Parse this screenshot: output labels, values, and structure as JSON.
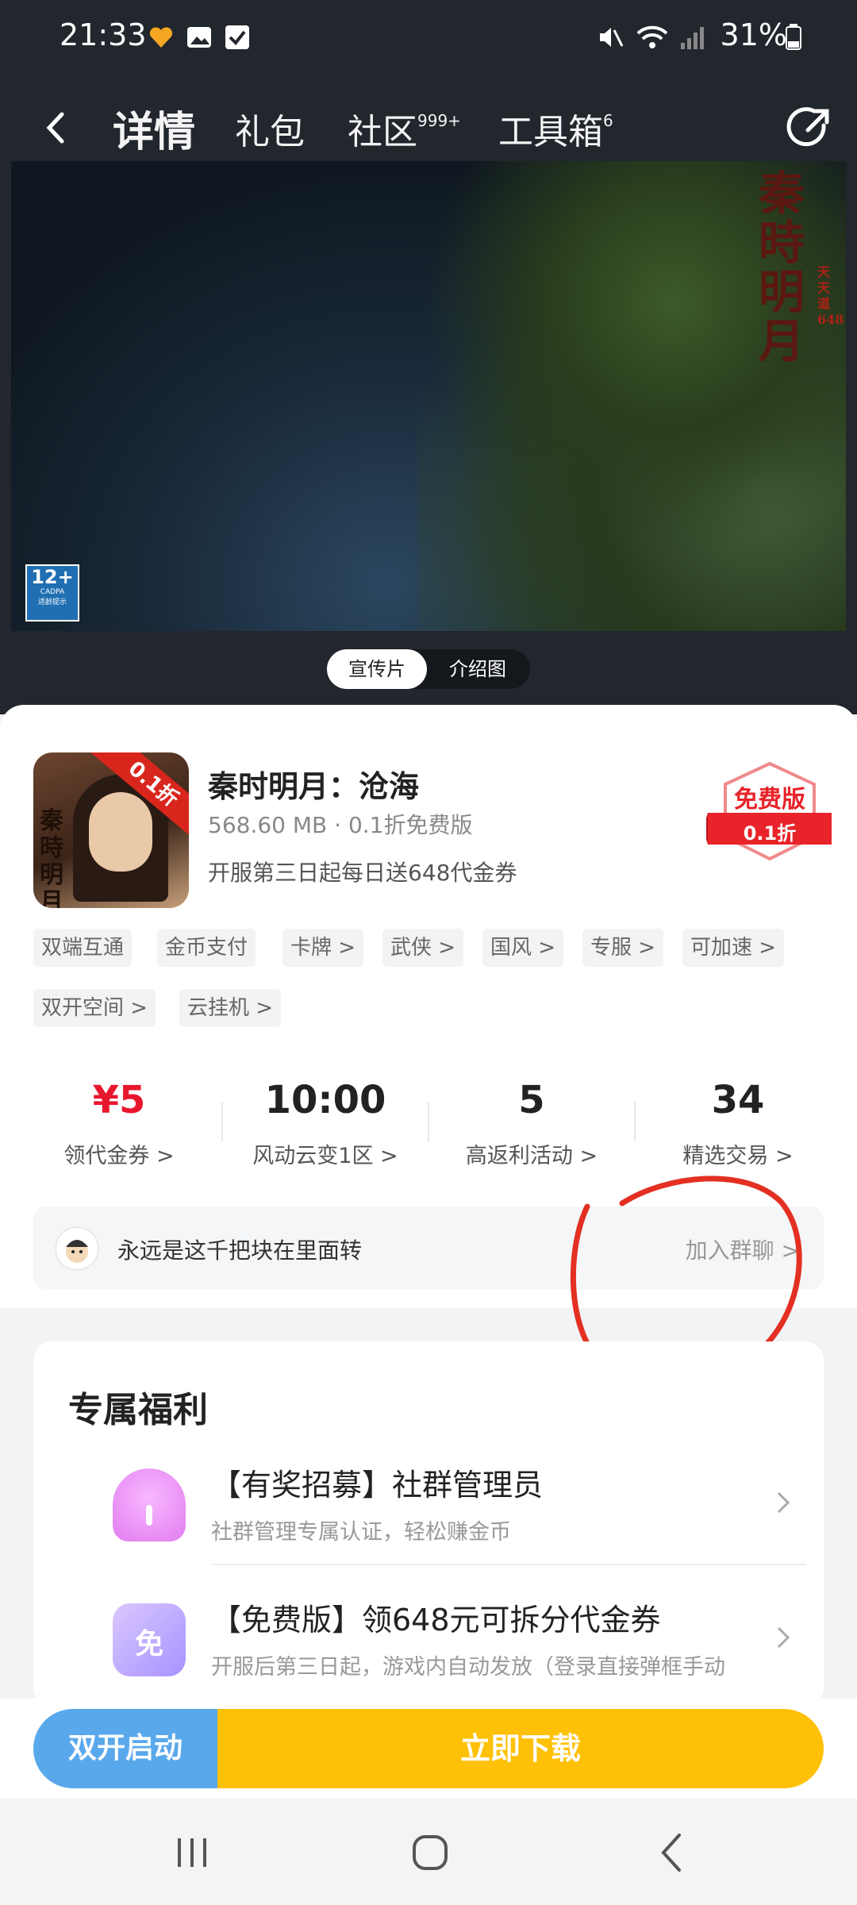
{
  "status_bar": {
    "time": "21:33",
    "battery": "31%"
  },
  "nav": {
    "tabs": [
      {
        "label": "详情",
        "badge": ""
      },
      {
        "label": "礼包",
        "badge": ""
      },
      {
        "label": "社区",
        "badge": "999+"
      },
      {
        "label": "工具箱",
        "badge": "6"
      }
    ]
  },
  "media": {
    "age_rating": "12+",
    "age_sub": "CADPA",
    "age_note": "适龄提示",
    "watermark": "秦時明月",
    "watermark_small": "天天道 648",
    "switch": [
      "宣传片",
      "介绍图"
    ]
  },
  "app": {
    "icon_ribbon": "0.1折",
    "icon_calli": "秦時明月",
    "title": "秦时明月：沧海",
    "meta": "568.60 MB · 0.1折免费版",
    "promo": "开服第三日起每日送648代金券",
    "badge_main": "免费版",
    "badge_sub": "0.1折"
  },
  "tags": [
    "双端互通",
    "金币支付",
    "卡牌 >",
    "武侠 >",
    "国风 >",
    "专服 >",
    "可加速 >",
    "双开空间 >",
    "云挂机 >"
  ],
  "stats": [
    {
      "value": "¥5",
      "label": "领代金券 >"
    },
    {
      "value": "10:00",
      "label": "风动云变1区 >"
    },
    {
      "value": "5",
      "label": "高返利活动 >"
    },
    {
      "value": "34",
      "label": "精选交易 >"
    }
  ],
  "chat": {
    "text": "永远是这千把块在里面转",
    "action": "加入群聊 >"
  },
  "benefits": {
    "title": "专属福利",
    "items": [
      {
        "title": "【有奖招募】社群管理员",
        "desc": "社群管理专属认证，轻松赚金币",
        "icon_char": ""
      },
      {
        "title": "【免费版】领648元可拆分代金券",
        "desc": "开服后第三日起，游戏内自动发放（登录直接弹框手动",
        "icon_char": "免"
      }
    ]
  },
  "bottom": {
    "dual_label": "双开启动",
    "download_label": "立即下载"
  },
  "colors": {
    "accent_red": "#e8162c",
    "download": "#ffc107",
    "dual": "#5aa8ec",
    "annotation": "#e33022"
  }
}
